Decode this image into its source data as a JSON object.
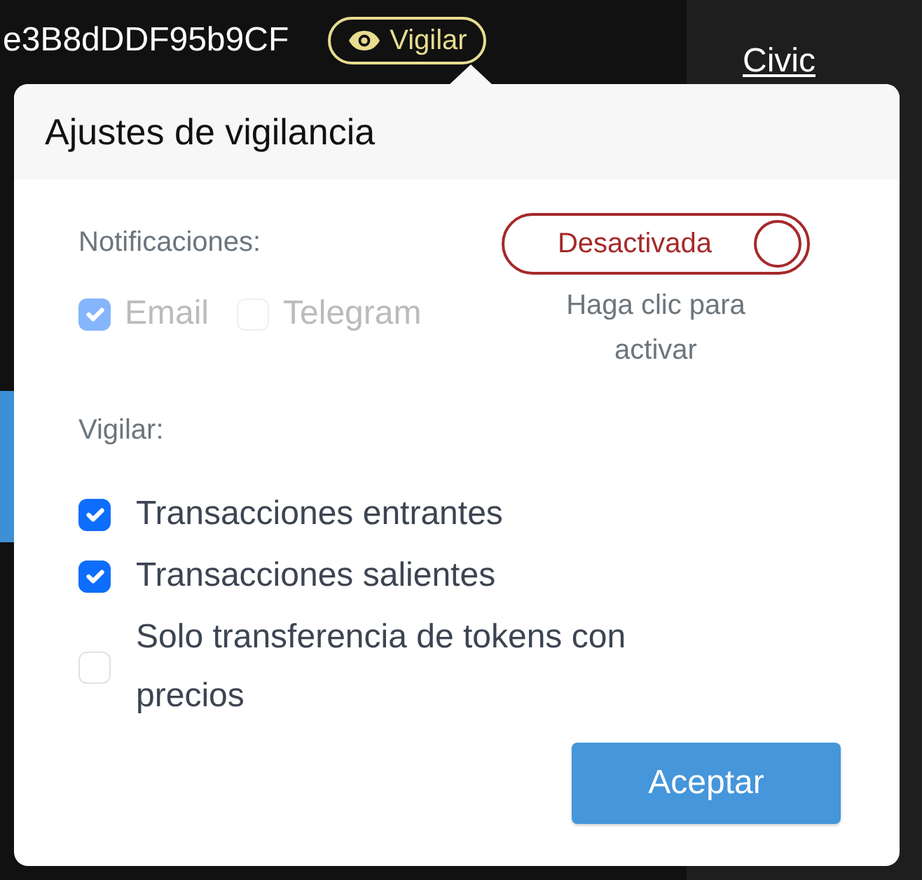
{
  "address": "e3B8dDDF95b9CF",
  "watch_button": "Vigilar",
  "side_link": "Civic",
  "popover": {
    "title": "Ajustes de vigilancia",
    "notifications_label": "Notificaciones:",
    "channels": [
      {
        "label": "Email",
        "checked": true,
        "disabled": true
      },
      {
        "label": "Telegram",
        "checked": false,
        "disabled": true
      }
    ],
    "toggle": {
      "label": "Desactivada",
      "on": false
    },
    "toggle_hint": "Haga clic para activar",
    "watch_label": "Vigilar:",
    "options": [
      {
        "label": "Transacciones entrantes",
        "checked": true
      },
      {
        "label": "Transacciones salientes",
        "checked": true
      },
      {
        "label": "Solo transferencia de tokens con precios",
        "checked": false
      }
    ],
    "button": "Aceptar"
  }
}
